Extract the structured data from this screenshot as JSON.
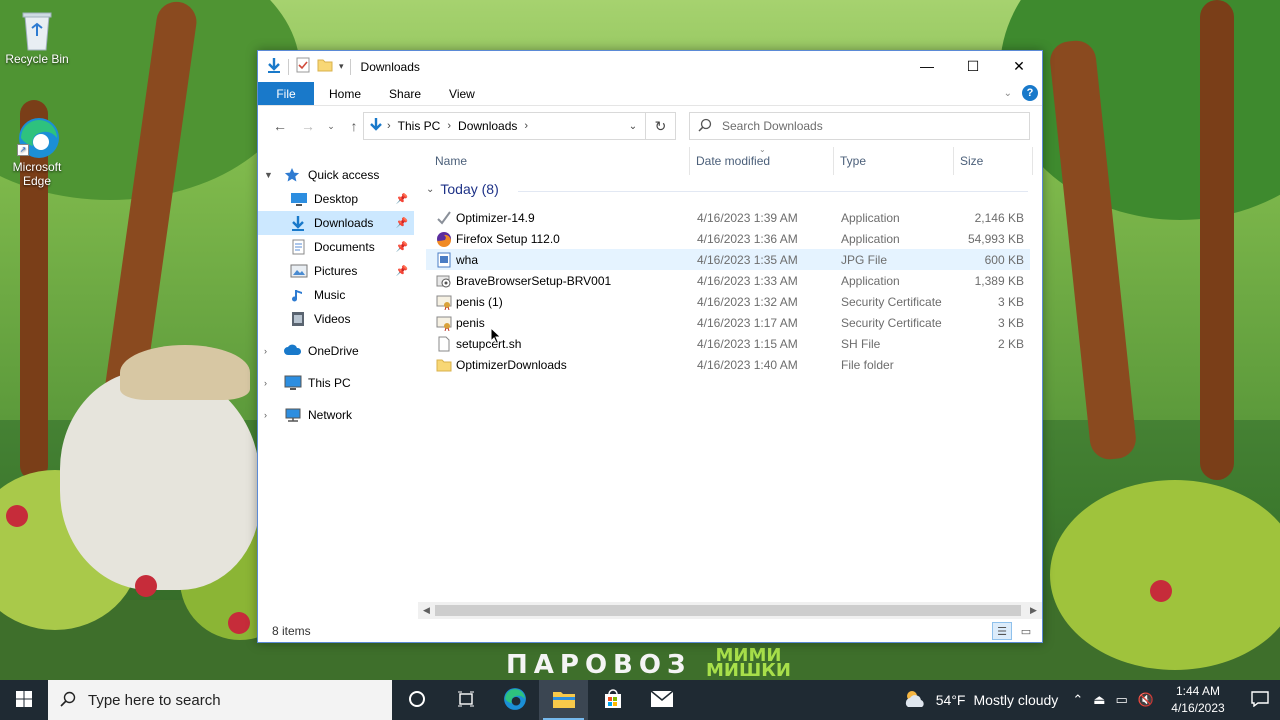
{
  "desktop": {
    "icons": [
      {
        "label": "Recycle Bin"
      },
      {
        "label": "Microsoft Edge"
      }
    ],
    "wallpaper_logo": "ПАРОВОЗ",
    "wallpaper_logo2_line1": "МИМИ",
    "wallpaper_logo2_line2": "МИШКИ"
  },
  "window": {
    "title": "Downloads",
    "controls": {
      "minimize": "—",
      "maximize": "☐",
      "close": "✕"
    },
    "ribbon_tabs": [
      {
        "label": "File"
      },
      {
        "label": "Home"
      },
      {
        "label": "Share"
      },
      {
        "label": "View"
      }
    ],
    "help_label": "?",
    "address": {
      "crumbs": [
        "This PC",
        "Downloads"
      ]
    },
    "search": {
      "placeholder": "Search Downloads"
    },
    "nav_pane": {
      "quick_access": "Quick access",
      "items": [
        {
          "label": "Desktop",
          "pinned": true
        },
        {
          "label": "Downloads",
          "pinned": true,
          "selected": true
        },
        {
          "label": "Documents",
          "pinned": true
        },
        {
          "label": "Pictures",
          "pinned": true
        },
        {
          "label": "Music"
        },
        {
          "label": "Videos"
        }
      ],
      "roots": [
        {
          "label": "OneDrive"
        },
        {
          "label": "This PC"
        },
        {
          "label": "Network"
        }
      ]
    },
    "columns": {
      "name": "Name",
      "date": "Date modified",
      "type": "Type",
      "size": "Size"
    },
    "group": {
      "label": "Today (8)"
    },
    "files": [
      {
        "name": "Optimizer-14.9",
        "date": "4/16/2023 1:39 AM",
        "type": "Application",
        "size": "2,146 KB",
        "icon": "optimizer-app-icon"
      },
      {
        "name": "Firefox Setup 112.0",
        "date": "4/16/2023 1:36 AM",
        "type": "Application",
        "size": "54,993 KB",
        "icon": "firefox-icon"
      },
      {
        "name": "wha",
        "date": "4/16/2023 1:35 AM",
        "type": "JPG File",
        "size": "600 KB",
        "icon": "jpg-file-icon"
      },
      {
        "name": "BraveBrowserSetup-BRV001",
        "date": "4/16/2023 1:33 AM",
        "type": "Application",
        "size": "1,389 KB",
        "icon": "brave-setup-icon"
      },
      {
        "name": "penis (1)",
        "date": "4/16/2023 1:32 AM",
        "type": "Security Certificate",
        "size": "3 KB",
        "icon": "certificate-icon"
      },
      {
        "name": "penis",
        "date": "4/16/2023 1:17 AM",
        "type": "Security Certificate",
        "size": "3 KB",
        "icon": "certificate-icon"
      },
      {
        "name": "setupcert.sh",
        "date": "4/16/2023 1:15 AM",
        "type": "SH File",
        "size": "2 KB",
        "icon": "generic-file-icon"
      },
      {
        "name": "OptimizerDownloads",
        "date": "4/16/2023 1:40 AM",
        "type": "File folder",
        "size": "",
        "icon": "folder-icon"
      }
    ],
    "status": {
      "item_count": "8 items"
    }
  },
  "taskbar": {
    "search_placeholder": "Type here to search",
    "weather": {
      "temp": "54°F",
      "condition": "Mostly cloudy"
    },
    "clock": {
      "time": "1:44 AM",
      "date": "4/16/2023"
    }
  },
  "colors": {
    "accent": "#1979ca",
    "selection": "#cce8ff",
    "hover": "#e5f3ff",
    "taskbar": "#1f2a33"
  }
}
